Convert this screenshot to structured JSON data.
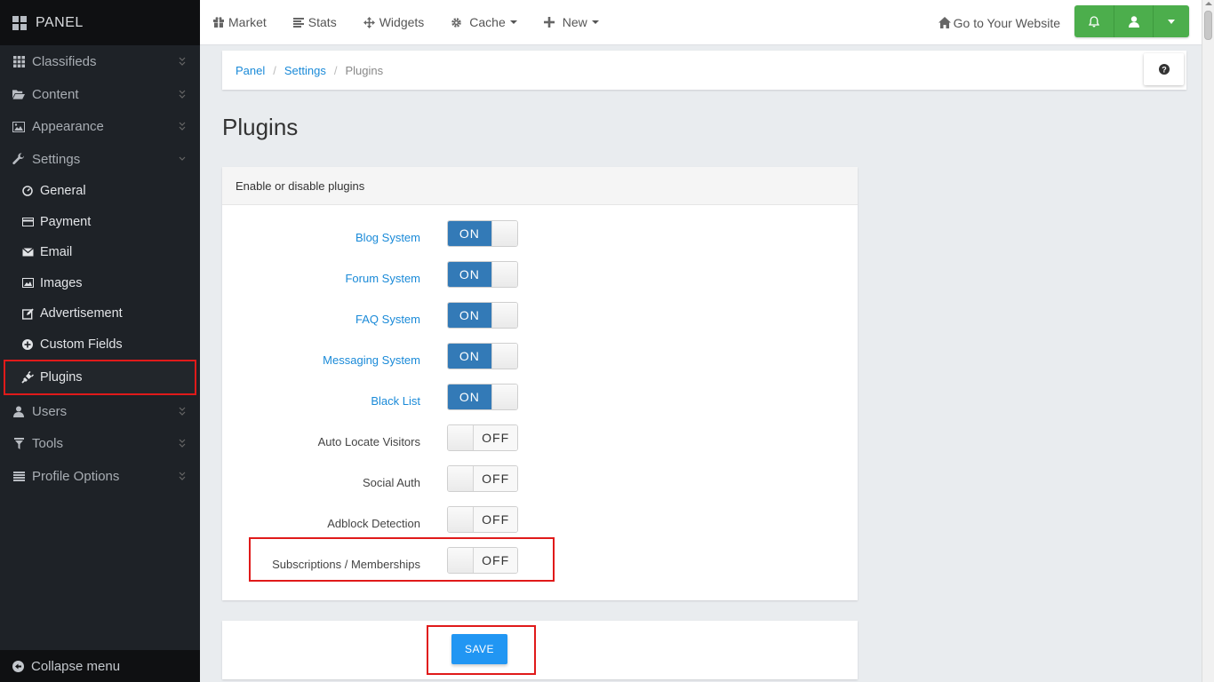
{
  "brand": "PANEL",
  "sidebar": {
    "items": [
      {
        "label": "Classifieds",
        "icon": "grid-icon"
      },
      {
        "label": "Content",
        "icon": "folder-open-icon"
      },
      {
        "label": "Appearance",
        "icon": "image-icon"
      },
      {
        "label": "Settings",
        "icon": "wrench-icon"
      }
    ],
    "settings_sub": [
      {
        "label": "General",
        "icon": "dashboard-icon"
      },
      {
        "label": "Payment",
        "icon": "credit-card-icon"
      },
      {
        "label": "Email",
        "icon": "envelope-icon"
      },
      {
        "label": "Images",
        "icon": "image-icon"
      },
      {
        "label": "Advertisement",
        "icon": "edit-icon"
      },
      {
        "label": "Custom Fields",
        "icon": "plus-circle-icon"
      },
      {
        "label": "Plugins",
        "icon": "plug-icon"
      }
    ],
    "items_after": [
      {
        "label": "Users",
        "icon": "user-icon"
      },
      {
        "label": "Tools",
        "icon": "filter-icon"
      },
      {
        "label": "Profile Options",
        "icon": "list-icon"
      }
    ],
    "collapse_label": "Collapse menu"
  },
  "topbar": {
    "market": "Market",
    "stats": "Stats",
    "widgets": "Widgets",
    "cache": "Cache",
    "new": "New",
    "goto": "Go to Your Website"
  },
  "breadcrumb": {
    "panel": "Panel",
    "settings": "Settings",
    "current": "Plugins"
  },
  "page_title": "Plugins",
  "panel": {
    "heading": "Enable or disable plugins",
    "plugins": [
      {
        "label": "Blog System",
        "state": "ON"
      },
      {
        "label": "Forum System",
        "state": "ON"
      },
      {
        "label": "FAQ System",
        "state": "ON"
      },
      {
        "label": "Messaging System",
        "state": "ON"
      },
      {
        "label": "Black List",
        "state": "ON"
      },
      {
        "label": "Auto Locate Visitors",
        "state": "OFF"
      },
      {
        "label": "Social Auth",
        "state": "OFF"
      },
      {
        "label": "Adblock Detection",
        "state": "OFF"
      },
      {
        "label": "Subscriptions / Memberships",
        "state": "OFF"
      }
    ]
  },
  "save_label": "SAVE",
  "colors": {
    "sidebar_bg": "#1e2227",
    "accent_blue": "#337ab7",
    "link_blue": "#1a8ad8",
    "success_green": "#4cae4c",
    "save_blue": "#2196f3",
    "highlight_red": "#e01a1a"
  }
}
